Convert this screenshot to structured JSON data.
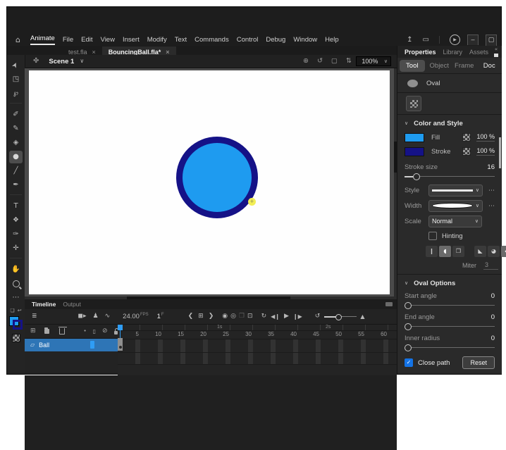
{
  "window": {
    "minimize": "–",
    "maximize": "▢"
  },
  "menubar": {
    "brand": "Animate",
    "items": [
      "File",
      "Edit",
      "View",
      "Insert",
      "Modify",
      "Text",
      "Commands",
      "Control",
      "Debug",
      "Window",
      "Help"
    ]
  },
  "doc_tabs": [
    {
      "label": "test.fla",
      "close": "×"
    },
    {
      "label": "BouncingBall.fla*",
      "close": "×"
    }
  ],
  "editbar": {
    "scene": "Scene 1",
    "zoom": "100%"
  },
  "colors": {
    "fill": "#1f9cf0",
    "stroke": "#151287",
    "selection": "#2e75b6",
    "playhead": "#2f9df5"
  },
  "properties": {
    "tabs": [
      "Properties",
      "Library",
      "Assets"
    ],
    "modes": [
      "Tool",
      "Object",
      "Frame",
      "Doc"
    ],
    "tool_name": "Oval",
    "color_section": {
      "title": "Color and Style",
      "fill_label": "Fill",
      "fill_alpha": "100 %",
      "stroke_label": "Stroke",
      "stroke_alpha": "100 %",
      "stroke_size_label": "Stroke size",
      "stroke_size": "16",
      "style_label": "Style",
      "width_label": "Width",
      "scale_label": "Scale",
      "scale_value": "Normal",
      "hinting_label": "Hinting",
      "miter_label": "Miter",
      "miter_value": "3"
    },
    "oval_section": {
      "title": "Oval Options",
      "start_angle_label": "Start angle",
      "start_angle": "0",
      "end_angle_label": "End angle",
      "end_angle": "0",
      "inner_radius_label": "Inner radius",
      "inner_radius": "0",
      "close_path_label": "Close path",
      "reset_label": "Reset"
    }
  },
  "timeline": {
    "tabs": [
      "Timeline",
      "Output"
    ],
    "fps": "24.00",
    "fps_unit": "FPS",
    "frame": "1",
    "frame_unit": "F",
    "seconds": [
      "1s",
      "2s"
    ],
    "ruler": [
      "5",
      "10",
      "15",
      "20",
      "25",
      "30",
      "35",
      "40",
      "45",
      "50",
      "55",
      "60"
    ],
    "layers": [
      {
        "name": "Ball"
      }
    ]
  },
  "icons": {
    "home": "⌂",
    "share": "↥",
    "workspace": "▭",
    "test_movie": "▶",
    "edit_scene": "✤",
    "scene_chevron": "∨",
    "center_stage": "⊕",
    "rotation": "↺",
    "clip_content": "▢",
    "zoom_stepper": "⇅",
    "dropdown_chevron": "∨",
    "selection": "➤",
    "free_transform": "◳",
    "lasso": "℘",
    "fluid_brush": "✐",
    "classic_brush": "✎",
    "eraser": "◈",
    "oval_tool": "●",
    "line": "╱",
    "pen": "✒",
    "text": "T",
    "paint_bucket": "❖",
    "eyedropper": "✑",
    "asset_warp": "✛",
    "hand": "✋",
    "more": "⋯",
    "default_colors": "❏",
    "swap_colors": "↩",
    "panel_more": "«",
    "section_chevron": "∨",
    "ellipsis": "⋯",
    "check": "✓",
    "cap_flat": "❙",
    "cap_round": "◖",
    "cap_square": "❒",
    "join_miter": "◣",
    "join_round": "◕",
    "join_bevel": "◆",
    "tl_layers": "≣",
    "tl_camera": "◼▸",
    "tl_person": "♟",
    "tl_graph": "∿",
    "prev_kf": "❮",
    "insert_kf": "⊞",
    "next_kf": "❯",
    "onion": "◉",
    "onion_outline": "◎",
    "edit_multi": "❐",
    "loop_range": "⊡",
    "loop": "↻",
    "step_back": "◀❙",
    "play": "▶",
    "step_fwd": "❙▶",
    "reset_tl": "↺",
    "tl_zoom": "▲",
    "add_layer": "⊞",
    "dot_col": "•",
    "outline_col": "▯",
    "hide_col": "⊘",
    "layer_page": "▱",
    "oval_cursor": "+"
  }
}
